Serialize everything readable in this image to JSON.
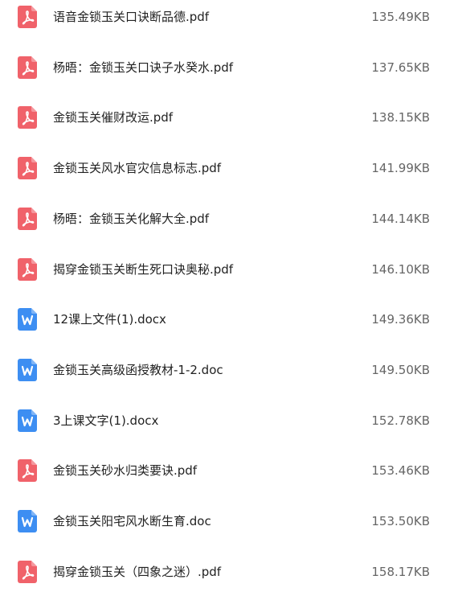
{
  "files": [
    {
      "name": "语音金锁玉关口诀断品德.pdf",
      "size": "135.49KB",
      "type": "pdf",
      "icon": "pdf-file-icon"
    },
    {
      "name": "杨晤：金锁玉关口诀子水癸水.pdf",
      "size": "137.65KB",
      "type": "pdf",
      "icon": "pdf-file-icon"
    },
    {
      "name": "金锁玉关催财改运.pdf",
      "size": "138.15KB",
      "type": "pdf",
      "icon": "pdf-file-icon"
    },
    {
      "name": "金锁玉关风水官灾信息标志.pdf",
      "size": "141.99KB",
      "type": "pdf",
      "icon": "pdf-file-icon"
    },
    {
      "name": "杨晤：金锁玉关化解大全.pdf",
      "size": "144.14KB",
      "type": "pdf",
      "icon": "pdf-file-icon"
    },
    {
      "name": "揭穿金锁玉关断生死口诀奥秘.pdf",
      "size": "146.10KB",
      "type": "pdf",
      "icon": "pdf-file-icon"
    },
    {
      "name": "12课上文件(1).docx",
      "size": "149.36KB",
      "type": "doc",
      "icon": "word-file-icon"
    },
    {
      "name": "金锁玉关高级函授教材-1-2.doc",
      "size": "149.50KB",
      "type": "doc",
      "icon": "word-file-icon"
    },
    {
      "name": "3上课文字(1).docx",
      "size": "152.78KB",
      "type": "doc",
      "icon": "word-file-icon"
    },
    {
      "name": "金锁玉关砂水归类要诀.pdf",
      "size": "153.46KB",
      "type": "pdf",
      "icon": "pdf-file-icon"
    },
    {
      "name": "金锁玉关阳宅风水断生育.doc",
      "size": "153.50KB",
      "type": "doc",
      "icon": "word-file-icon"
    },
    {
      "name": "揭穿金锁玉关（四象之迷）.pdf",
      "size": "158.17KB",
      "type": "pdf",
      "icon": "pdf-file-icon"
    }
  ],
  "colors": {
    "pdf_icon": "#f0626a",
    "word_icon": "#3d8ef2",
    "name_text": "#222222",
    "size_text": "#666666"
  }
}
